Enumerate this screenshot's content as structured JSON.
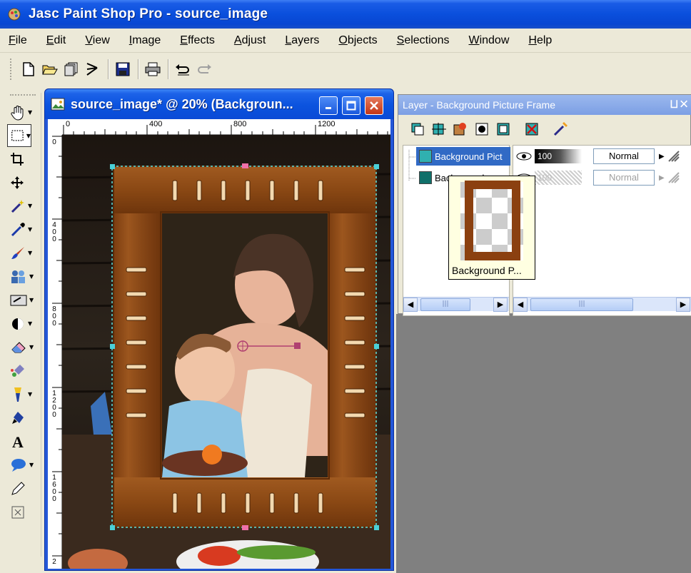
{
  "app": {
    "title": "Jasc Paint Shop Pro - source_image"
  },
  "menu": [
    {
      "label": "File",
      "u": "F",
      "rest": "ile"
    },
    {
      "label": "Edit",
      "u": "E",
      "rest": "dit"
    },
    {
      "label": "View",
      "u": "V",
      "rest": "iew"
    },
    {
      "label": "Image",
      "u": "I",
      "rest": "mage"
    },
    {
      "label": "Effects",
      "u": "E",
      "rest": "ffects"
    },
    {
      "label": "Adjust",
      "u": "A",
      "rest": "djust"
    },
    {
      "label": "Layers",
      "u": "L",
      "rest": "ayers"
    },
    {
      "label": "Objects",
      "u": "O",
      "rest": "bjects"
    },
    {
      "label": "Selections",
      "u": "S",
      "rest": "elections"
    },
    {
      "label": "Window",
      "u": "W",
      "rest": "indow"
    },
    {
      "label": "Help",
      "u": "H",
      "rest": "elp"
    }
  ],
  "document": {
    "title": "source_image* @  20% (Backgroun...",
    "ruler_top": [
      "0",
      "400",
      "800",
      "1200"
    ],
    "ruler_left": [
      "0",
      "400",
      "800",
      "1200",
      "1600",
      "2"
    ]
  },
  "layers_palette": {
    "title": "Layer - Background Picture Frame",
    "pin_icons": "⨆ ✕",
    "layers": [
      {
        "name": "Background Pict",
        "opacity": "100",
        "blend": "Normal",
        "selected": true
      },
      {
        "name": "Background",
        "opacity": "100",
        "blend": "Normal",
        "selected": false
      }
    ],
    "tooltip": "Background P..."
  },
  "colors": {
    "title_blue": "#0a4fdc",
    "selection_blue": "#316ac5",
    "frame_wood": "#8b4a14",
    "workspace_gray": "#808080"
  }
}
